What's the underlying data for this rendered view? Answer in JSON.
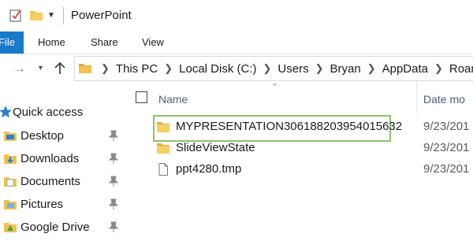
{
  "window": {
    "title": "PowerPoint"
  },
  "ribbon": {
    "file_tab": "File",
    "tabs": [
      "Home",
      "Share",
      "View"
    ]
  },
  "address_bar": {
    "breadcrumbs": [
      "This PC",
      "Local Disk (C:)",
      "Users",
      "Bryan",
      "AppData",
      "Roaming"
    ]
  },
  "sidebar": {
    "quick_access": "Quick access",
    "items": [
      {
        "label": "Desktop",
        "icon": "desktop-folder-icon",
        "pinned": true
      },
      {
        "label": "Downloads",
        "icon": "downloads-folder-icon",
        "pinned": true
      },
      {
        "label": "Documents",
        "icon": "documents-folder-icon",
        "pinned": true
      },
      {
        "label": "Pictures",
        "icon": "pictures-folder-icon",
        "pinned": true
      },
      {
        "label": "Google Drive",
        "icon": "google-drive-icon",
        "pinned": true
      }
    ]
  },
  "file_list": {
    "columns": {
      "name": "Name",
      "date": "Date mo"
    },
    "rows": [
      {
        "name": "MYPRESENTATION306188203954015632",
        "date": "9/23/201",
        "icon": "folder-icon",
        "highlighted": true
      },
      {
        "name": "SlideViewState",
        "date": "9/23/201",
        "icon": "folder-icon",
        "highlighted": false
      },
      {
        "name": "ppt4280.tmp",
        "date": "9/23/201",
        "icon": "file-icon",
        "highlighted": false
      }
    ]
  },
  "colors": {
    "accent": "#1979ca",
    "folder": "#f2c14e",
    "highlight_border": "#8dc06a"
  }
}
